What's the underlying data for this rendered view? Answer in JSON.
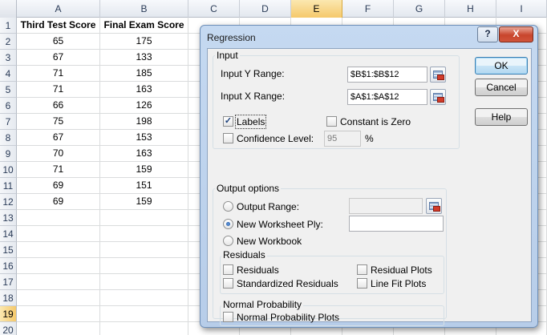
{
  "sheet": {
    "columns": [
      "A",
      "B",
      "C",
      "D",
      "E",
      "F",
      "G",
      "H",
      "I"
    ],
    "active_column": "E",
    "rows": [
      "1",
      "2",
      "3",
      "4",
      "5",
      "6",
      "7",
      "8",
      "9",
      "10",
      "11",
      "12",
      "13",
      "14",
      "15",
      "16",
      "17",
      "18",
      "19",
      "20"
    ],
    "active_row": "19",
    "headers": [
      "Third Test Score",
      "Final Exam Score"
    ],
    "data": [
      [
        "65",
        "175"
      ],
      [
        "67",
        "133"
      ],
      [
        "71",
        "185"
      ],
      [
        "71",
        "163"
      ],
      [
        "66",
        "126"
      ],
      [
        "75",
        "198"
      ],
      [
        "67",
        "153"
      ],
      [
        "70",
        "163"
      ],
      [
        "71",
        "159"
      ],
      [
        "69",
        "151"
      ],
      [
        "69",
        "159"
      ]
    ]
  },
  "dialog": {
    "title": "Regression",
    "help_button": "?",
    "close_button": "X",
    "input_group": "Input",
    "input_y_label": "Input Y Range:",
    "input_y_value": "$B$1:$B$12",
    "input_x_label": "Input X Range:",
    "input_x_value": "$A$1:$A$12",
    "labels": "Labels",
    "labels_checked": true,
    "constant_zero": "Constant is Zero",
    "confidence_level": "Confidence Level:",
    "confidence_value": "95",
    "percent": "%",
    "output_group": "Output options",
    "output_range": "Output Range:",
    "new_worksheet_ply": "New Worksheet Ply:",
    "new_workbook": "New Workbook",
    "residuals_group": "Residuals",
    "residuals": "Residuals",
    "standardized_residuals": "Standardized Residuals",
    "residual_plots": "Residual Plots",
    "line_fit_plots": "Line Fit Plots",
    "normal_group": "Normal Probability",
    "normal_plots": "Normal Probability Plots",
    "ok": "OK",
    "cancel": "Cancel",
    "help": "Help"
  }
}
